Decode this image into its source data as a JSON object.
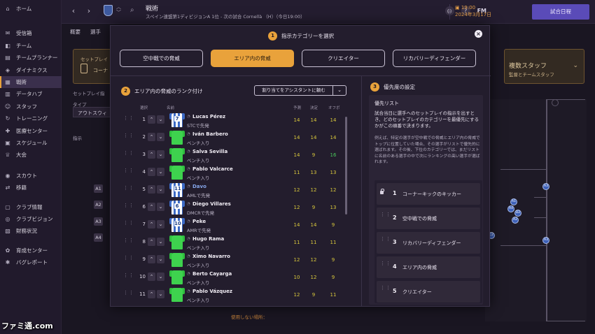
{
  "sidebar": {
    "items": [
      {
        "label": "ホーム",
        "icon": "home-icon"
      },
      {
        "label": "受信箱",
        "icon": "mail-icon"
      },
      {
        "label": "チーム",
        "icon": "shirt-icon"
      },
      {
        "label": "チームプランナー",
        "icon": "planner-icon"
      },
      {
        "label": "ダイナミクス",
        "icon": "dynamics-icon"
      },
      {
        "label": "戦術",
        "icon": "tactics-icon",
        "active": true
      },
      {
        "label": "データハブ",
        "icon": "data-icon"
      },
      {
        "label": "スタッフ",
        "icon": "staff-icon"
      },
      {
        "label": "トレーニング",
        "icon": "training-icon"
      },
      {
        "label": "医療センター",
        "icon": "medical-icon"
      },
      {
        "label": "スケジュール",
        "icon": "calendar-icon"
      },
      {
        "label": "大会",
        "icon": "trophy-icon"
      },
      {
        "label": "スカウト",
        "icon": "scout-icon"
      },
      {
        "label": "移籍",
        "icon": "transfer-icon"
      },
      {
        "label": "クラブ情報",
        "icon": "club-info-icon"
      },
      {
        "label": "クラブビジョン",
        "icon": "vision-icon"
      },
      {
        "label": "財務状況",
        "icon": "finance-icon"
      },
      {
        "label": "育成センター",
        "icon": "youth-icon"
      },
      {
        "label": "バグレポート",
        "icon": "bug-icon"
      }
    ]
  },
  "topbar": {
    "title": "戦術",
    "subtitle": "スペイン連盟第1ディビジョンA 1位 - 次の試合 Cornellà （H）（今日19:00）",
    "date_time": "19:00",
    "date": "2024年3月17日",
    "continue_label": "試合日程",
    "fm_label": "FM"
  },
  "background": {
    "subtabs": [
      "概要",
      "選手"
    ],
    "setplay_label": "セットプレイ",
    "setplay_value": "コーナ",
    "left_label1": "セットプレイ指",
    "type_label": "タイプ",
    "type_value": "アウトスウィ",
    "instructions_label": "指示",
    "badges": [
      "A1",
      "A2",
      "A3",
      "A4"
    ],
    "right_title": "複数スタッフ",
    "right_sub": "監督とチームスタッフ",
    "footer_text": "使用しない場所："
  },
  "modal": {
    "step1_num": "1",
    "step1_title": "指示カテゴリーを選択",
    "categories": [
      {
        "label": "空中戦での脅威",
        "selected": false
      },
      {
        "label": "エリア内の脅威",
        "selected": true
      },
      {
        "label": "クリエイター",
        "selected": false
      },
      {
        "label": "リカバリーディフェンダー",
        "selected": false
      }
    ],
    "step2_num": "2",
    "step2_title": "エリア内の脅威のランク付け",
    "assign_label": "割り当てをアシスタントに頼む",
    "columns": {
      "rank": "選択",
      "name": "名前",
      "c1": "予測",
      "c2": "決定",
      "c3": "オフボ"
    },
    "players": [
      {
        "rank": "1",
        "num": "7",
        "kit": "outfield",
        "name": "Lucas Pérez",
        "status": "STCで先発",
        "v1": "14",
        "v2": "14",
        "v3": "14",
        "v3green": false,
        "link": false
      },
      {
        "rank": "2",
        "num": "",
        "kit": "gk",
        "name": "Iván Barbero",
        "status": "ベンチ入り",
        "v1": "14",
        "v2": "14",
        "v3": "14",
        "v3green": false,
        "link": false
      },
      {
        "rank": "3",
        "num": "",
        "kit": "gk",
        "name": "Salva Sevilla",
        "status": "ベンチ入り",
        "v1": "14",
        "v2": "9",
        "v3": "16",
        "v3green": true,
        "link": false
      },
      {
        "rank": "4",
        "num": "",
        "kit": "gk",
        "name": "Pablo Valcarce",
        "status": "ベンチ入り",
        "v1": "11",
        "v2": "13",
        "v3": "13",
        "v3green": false,
        "link": false
      },
      {
        "rank": "5",
        "num": "11",
        "kit": "outfield",
        "name": "Davo",
        "status": "AMLで先発",
        "v1": "12",
        "v2": "12",
        "v3": "12",
        "v3green": false,
        "link": true
      },
      {
        "rank": "6",
        "num": "6",
        "kit": "outfield",
        "name": "Diego Villares",
        "status": "DMCRで先発",
        "v1": "12",
        "v2": "9",
        "v3": "13",
        "v3green": false,
        "link": false
      },
      {
        "rank": "7",
        "num": "10",
        "kit": "outfield",
        "name": "Peke",
        "status": "AMRで先発",
        "v1": "14",
        "v2": "14",
        "v3": "9",
        "v3green": false,
        "link": false
      },
      {
        "rank": "8",
        "num": "",
        "kit": "gk",
        "name": "Hugo Rama",
        "status": "ベンチ入り",
        "v1": "11",
        "v2": "11",
        "v3": "11",
        "v3green": false,
        "link": false
      },
      {
        "rank": "9",
        "num": "",
        "kit": "gk",
        "name": "Ximo Navarro",
        "status": "ベンチ入り",
        "v1": "12",
        "v2": "12",
        "v3": "9",
        "v3green": false,
        "link": false
      },
      {
        "rank": "10",
        "num": "",
        "kit": "gk",
        "name": "Berto Cayarga",
        "status": "ベンチ入り",
        "v1": "10",
        "v2": "12",
        "v3": "9",
        "v3green": false,
        "link": false
      },
      {
        "rank": "11",
        "num": "",
        "kit": "gk",
        "name": "Pablo Vázquez",
        "status": "ベンチ入り",
        "v1": "12",
        "v2": "9",
        "v3": "11",
        "v3green": false,
        "link": false
      }
    ],
    "step3_num": "3",
    "step3_title": "優先度の設定",
    "priority_title": "優先リスト",
    "priority_desc1": "試合当日に選手へのセットプレイの指示を出すとき、どのセットプレイのカテゴリーを最優先にするかがこの順番で決まります。",
    "priority_desc2": "例えば、特定の選手が空中戦での脅威とエリア内の脅威でトップに位置していた場合、その選手がリストで優先的に選ばれます。その後、下位のカテゴリーでは、まだリストに名前のある選手の中で次にランキングの高い選手が選ばれます。",
    "priorities": [
      {
        "num": "1",
        "label": "コーナーキックのキッカー",
        "locked": true
      },
      {
        "num": "2",
        "label": "空中戦での脅威",
        "locked": false
      },
      {
        "num": "3",
        "label": "リカバリーディフェンダー",
        "locked": false
      },
      {
        "num": "4",
        "label": "エリア内の脅威",
        "locked": false
      },
      {
        "num": "5",
        "label": "クリエイター",
        "locked": false
      }
    ]
  },
  "pitch_markers": [
    "A3",
    "A1",
    "A4",
    "D2",
    "A2",
    "C2",
    "A3"
  ],
  "watermark": "ファミ通.com",
  "colors": {
    "accent": "#e9a23b",
    "continue": "#5a4bb8",
    "link": "#86a6ea",
    "value_yellow": "#d9c83c",
    "value_green": "#49c85a"
  }
}
